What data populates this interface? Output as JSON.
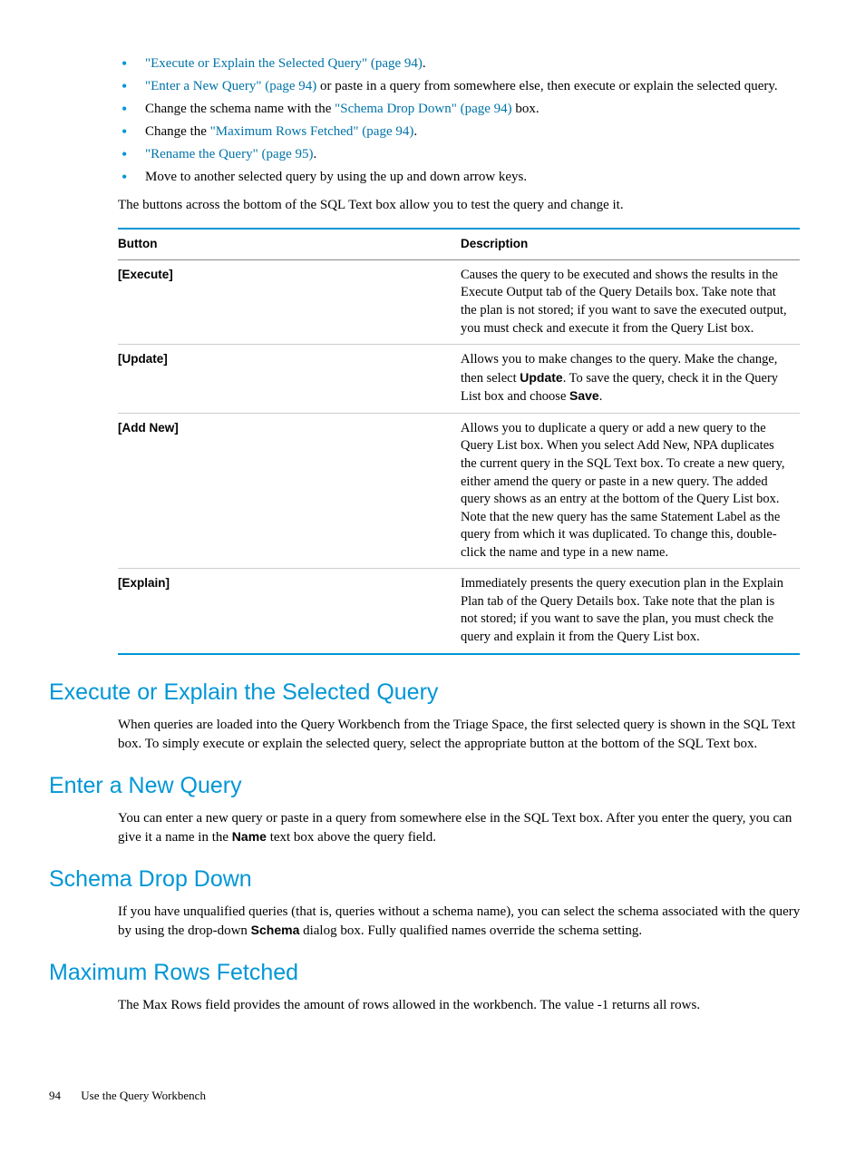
{
  "bullets": [
    {
      "pre": "",
      "link": "\"Execute or Explain the Selected Query\" (page 94)",
      "post": "."
    },
    {
      "pre": "",
      "link": "\"Enter a New Query\" (page 94)",
      "post": " or paste in a query from somewhere else, then execute or explain the selected query."
    },
    {
      "pre": "Change the schema name with the ",
      "link": "\"Schema Drop Down\" (page 94)",
      "post": " box."
    },
    {
      "pre": "Change the ",
      "link": "\"Maximum Rows Fetched\" (page 94)",
      "post": "."
    },
    {
      "pre": "",
      "link": "\"Rename the Query\" (page 95)",
      "post": "."
    },
    {
      "pre": "Move to another selected query by using the up and down arrow keys.",
      "link": "",
      "post": ""
    }
  ],
  "intro_after_bullets": "The buttons across the bottom of the SQL Text box allow you to test the query and change it.",
  "table": {
    "headers": {
      "col1": "Button",
      "col2": "Description"
    },
    "rows": [
      {
        "btn": "[Execute]",
        "desc": [
          {
            "t": "Causes the query to be executed and shows the results in the Execute Output tab of the Query Details box. Take note that the plan is not stored; if you want to save the executed output, you must check and execute it from the Query List box."
          }
        ]
      },
      {
        "btn": "[Update]",
        "desc": [
          {
            "t": "Allows you to make changes to the query. Make the change, then select "
          },
          {
            "b": "Update"
          },
          {
            "t": ". To save the query, check it in the Query List box and choose "
          },
          {
            "b": "Save"
          },
          {
            "t": "."
          }
        ]
      },
      {
        "btn": "[Add New]",
        "desc": [
          {
            "t": "Allows you to duplicate a query or add a new query to the Query List box. When you select Add New, NPA duplicates the current query in the SQL Text box. To create a new query, either amend the query or paste in a new query. The added query shows as an entry at the bottom of the Query List box. Note that the new query has the same Statement Label as the query from which it was duplicated. To change this, double-click the name and type in a new name."
          }
        ]
      },
      {
        "btn": "[Explain]",
        "desc": [
          {
            "t": "Immediately presents the query execution plan in the Explain Plan tab of the Query Details box. Take note that the plan is not stored; if you want to save the plan, you must check the query and explain it from the Query List box."
          }
        ]
      }
    ]
  },
  "sections": [
    {
      "title": "Execute or Explain the Selected Query",
      "paras": [
        [
          {
            "t": "When queries are loaded into the Query Workbench from the Triage Space, the first selected query is shown in the SQL Text box. To simply execute or explain the selected query, select the appropriate button at the bottom of the SQL Text box."
          }
        ]
      ]
    },
    {
      "title": "Enter a New Query",
      "paras": [
        [
          {
            "t": "You can enter a new query or paste in a query from somewhere else in the SQL Text box. After you enter the query, you can give it a name in the "
          },
          {
            "b": "Name"
          },
          {
            "t": " text box above the query field."
          }
        ]
      ]
    },
    {
      "title": "Schema Drop Down",
      "paras": [
        [
          {
            "t": "If you have unqualified queries (that is, queries without a schema name), you can select the schema associated with the query by using the drop-down "
          },
          {
            "b": "Schema"
          },
          {
            "t": " dialog box. Fully qualified names override the schema setting."
          }
        ]
      ]
    },
    {
      "title": "Maximum Rows Fetched",
      "paras": [
        [
          {
            "t": "The Max Rows field provides the amount of rows allowed in the workbench. The value -1 returns all rows."
          }
        ]
      ]
    }
  ],
  "footer": {
    "page": "94",
    "chapter": "Use the Query Workbench"
  }
}
